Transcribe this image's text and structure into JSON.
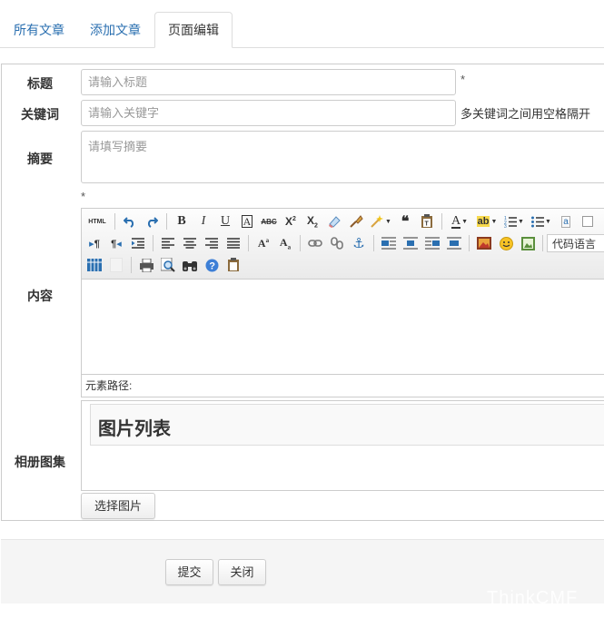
{
  "tabs": [
    {
      "label": "所有文章"
    },
    {
      "label": "添加文章"
    },
    {
      "label": "页面编辑"
    }
  ],
  "form": {
    "title": {
      "label": "标题",
      "placeholder": "请输入标题",
      "required_mark": "*"
    },
    "keywords": {
      "label": "关键词",
      "placeholder": "请输入关键字",
      "hint": "多关键词之间用空格隔开"
    },
    "summary": {
      "label": "摘要",
      "placeholder": "请填写摘要"
    },
    "content": {
      "label": "内容",
      "required_mark": "*"
    },
    "album": {
      "label": "相册图集",
      "title": "图片列表",
      "choose_button": "选择图片"
    }
  },
  "editor": {
    "toolbar_row1": [
      "html-source-icon",
      "undo-icon",
      "redo-icon",
      "bold-icon",
      "italic-icon",
      "underline-icon",
      "font-border-icon",
      "strikethrough-icon",
      "superscript-icon",
      "subscript-icon",
      "eraser-icon",
      "format-painter-icon",
      "auto-typeset-icon",
      "blockquote-icon",
      "paste-plain-icon",
      "font-color-icon",
      "background-color-icon",
      "ordered-list-icon",
      "unordered-list-icon",
      "select-all-icon"
    ],
    "toolbar_row2": [
      "ltr-icon",
      "rtl-icon",
      "indent-icon",
      "align-left-icon",
      "align-center-icon",
      "align-right-icon",
      "align-justify-icon",
      "to-uppercase-icon",
      "to-lowercase-icon",
      "link-icon",
      "unlink-icon",
      "anchor-icon",
      "image-none-icon",
      "image-left-icon",
      "image-right-icon",
      "image-center-icon",
      "insert-image-icon",
      "emotion-icon",
      "insert-video-icon"
    ],
    "code_language_label": "代码语言",
    "toolbar_row3": [
      "insert-table-icon",
      "blank-icon",
      "print-icon",
      "preview-icon",
      "search-replace-icon",
      "help-icon",
      "draft-icon"
    ],
    "element_path_label": "元素路径:"
  },
  "footer": {
    "submit": "提交",
    "close": "关闭"
  },
  "watermark": "ThinkCMF",
  "colors": {
    "tab_link": "#2a6fb0",
    "border": "#cccccc",
    "footer_bg": "#f5f5f5"
  }
}
